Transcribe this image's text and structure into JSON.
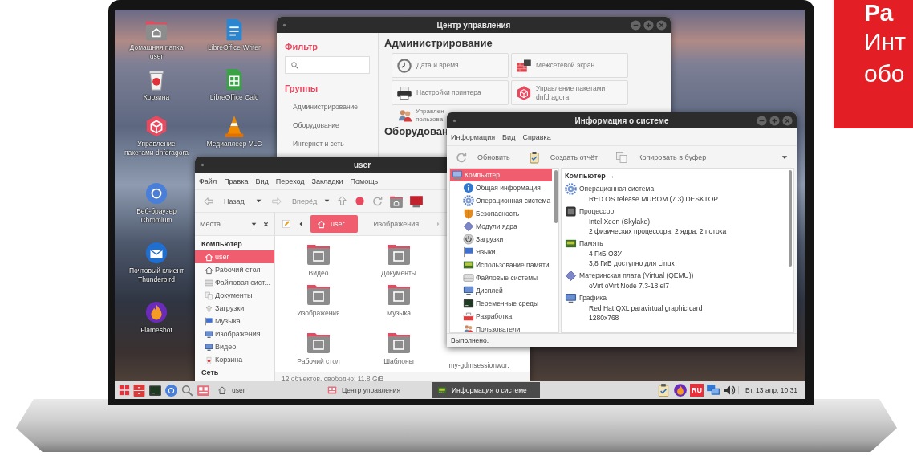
{
  "banner": {
    "title": "Ра",
    "lines": [
      "Инт",
      "обо"
    ]
  },
  "desktop_icons": [
    {
      "label": "Домашняя папка user"
    },
    {
      "label": "Корзина"
    },
    {
      "label": "Управление пакетами dnfdragora"
    },
    {
      "label": "Веб-браузер Chromium"
    },
    {
      "label": "Почтовый клиент Thunderbird"
    },
    {
      "label": "Flameshot"
    },
    {
      "label": "LibreOffice Writer"
    },
    {
      "label": "LibreOffice Calc"
    },
    {
      "label": "Медиаплеер VLC"
    }
  ],
  "control_center": {
    "title": "Центр управления",
    "filter_heading": "Фильтр",
    "groups_heading": "Группы",
    "groups": [
      "Администрирование",
      "Оборудование",
      "Интернет и сеть"
    ],
    "section_title": "Администрирование",
    "tiles": [
      {
        "label": "Дата и время"
      },
      {
        "label": "Межсетевой экран"
      },
      {
        "label": "Настройки принтера"
      },
      {
        "label": "Управление пакетами dnfdragora"
      }
    ],
    "partial_item": [
      "Управлен",
      "пользова"
    ],
    "next_section_title": "Оборудован"
  },
  "file_manager": {
    "title": "user",
    "menu": [
      "Файл",
      "Правка",
      "Вид",
      "Переход",
      "Закладки",
      "Помощь"
    ],
    "back": {
      "label": "Назад",
      "disabled": false
    },
    "forward": {
      "label": "Вперёд",
      "disabled": true
    },
    "places_label": "Места",
    "path": [
      {
        "label": "user",
        "selected": true
      },
      {
        "label": "Изображения",
        "selected": false
      }
    ],
    "sidebar": [
      {
        "kind": "header",
        "label": "Компьютер",
        "selected": false
      },
      {
        "kind": "place",
        "label": "user",
        "selected": true
      },
      {
        "kind": "place",
        "label": "Рабочий стол",
        "selected": false
      },
      {
        "kind": "place",
        "label": "Файловая сист...",
        "selected": false
      },
      {
        "kind": "place",
        "label": "Документы",
        "selected": false
      },
      {
        "kind": "place",
        "label": "Загрузки",
        "selected": false
      },
      {
        "kind": "place",
        "label": "Музыка",
        "selected": false
      },
      {
        "kind": "place",
        "label": "Изображения",
        "selected": false
      },
      {
        "kind": "place",
        "label": "Видео",
        "selected": false
      },
      {
        "kind": "place",
        "label": "Корзина",
        "selected": false
      },
      {
        "kind": "header",
        "label": "Сеть",
        "selected": false
      }
    ],
    "files": [
      {
        "kind": "folder",
        "label": "Видео"
      },
      {
        "kind": "folder",
        "label": "Документы"
      },
      {
        "kind": "folder",
        "label": "Изображения"
      },
      {
        "kind": "folder",
        "label": "Музыка"
      },
      {
        "kind": "folder",
        "label": "Рабочий стол"
      },
      {
        "kind": "folder",
        "label": "Шаблоны"
      },
      {
        "kind": "file",
        "label": "my-gdmsessionwor."
      }
    ],
    "status": "12 объектов, свободно: 11,8 GiB"
  },
  "system_info": {
    "title": "Информация о системе",
    "menu": [
      "Информация",
      "Вид",
      "Справка"
    ],
    "toolbar": [
      "Обновить",
      "Создать отчёт",
      "Копировать в буфер"
    ],
    "tree": [
      {
        "label": "Компьютер",
        "selected": true,
        "children": [
          {
            "label": "Общая информация",
            "selected": false
          },
          {
            "label": "Операционная система",
            "selected": false
          },
          {
            "label": "Безопасность",
            "selected": false
          },
          {
            "label": "Модули ядра",
            "selected": false
          },
          {
            "label": "Загрузки",
            "selected": false
          },
          {
            "label": "Языки",
            "selected": false
          },
          {
            "label": "Использование памяти",
            "selected": false
          },
          {
            "label": "Файловые системы",
            "selected": false
          },
          {
            "label": "Дисплей",
            "selected": false
          },
          {
            "label": "Переменные среды",
            "selected": false
          },
          {
            "label": "Разработка",
            "selected": false
          },
          {
            "label": "Пользователи",
            "selected": false
          }
        ]
      }
    ],
    "details_title": "Компьютер →",
    "sections": [
      {
        "title": "Операционная система",
        "values": [
          "RED OS release MUROM (7.3) DESKTOP"
        ]
      },
      {
        "title": "Процессор",
        "values": [
          "Intel Xeon (Skylake)",
          "2 физических процессора; 2 ядра; 2 потока"
        ]
      },
      {
        "title": "Память",
        "values": [
          "4 ГиБ ОЗУ",
          "3,8 ГиБ доступно для Linux"
        ]
      },
      {
        "title": "Материнская плата (Virtual (QEMU))",
        "values": [
          "oVirt oVirt Node 7.3-18.el7"
        ]
      },
      {
        "title": "Графика",
        "values": [
          "Red Hat QXL paravirtual graphic card",
          "1280x768"
        ]
      }
    ],
    "status": "Выполнено."
  },
  "taskbar": {
    "tasks": [
      {
        "label": "user",
        "selected": false
      },
      {
        "label": "Центр управления",
        "selected": false
      },
      {
        "label": "Информация о системе",
        "selected": true
      }
    ],
    "language": "RU",
    "clock": "Вт, 13 апр, 10:31"
  }
}
